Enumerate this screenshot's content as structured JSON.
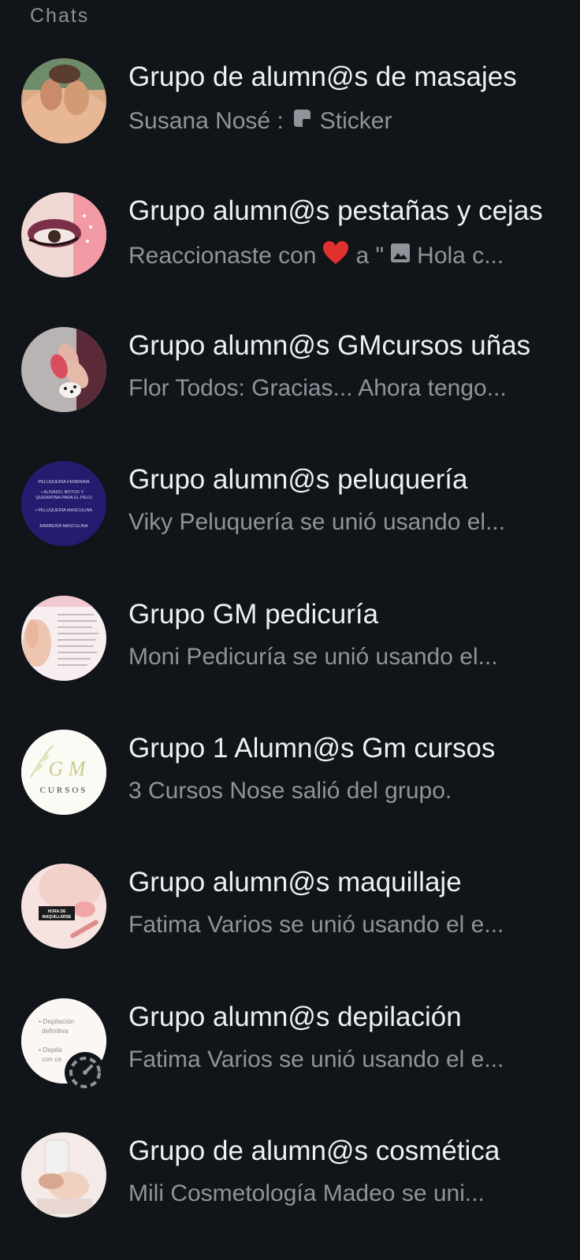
{
  "header": {
    "label": "Chats"
  },
  "chats": [
    {
      "title": "Grupo de alumn@s de masajes",
      "sender": "Susana Nosé :",
      "preview_icon": "sticker-icon",
      "preview": "Sticker",
      "avatar_icon": "massage-photo-avatar"
    },
    {
      "title": "Grupo alumn@s pestañas y cejas",
      "prefix": "Reaccionaste con",
      "reaction_icon": "heart-icon",
      "middle": "a \"",
      "preview_icon": "image-icon",
      "preview": "Hola c...",
      "avatar_icon": "eye-makeup-avatar"
    },
    {
      "title": "Grupo alumn@s GMcursos uñas",
      "preview": "Flor Todos: Gracias... Ahora tengo...",
      "avatar_icon": "nails-avatar"
    },
    {
      "title": "Grupo alumn@s peluquería",
      "preview": "Viky Peluquería se unió usando el...",
      "avatar_icon": "hairdressing-flyer-avatar",
      "avatar_text": [
        "PELUQUERÍA FEMENINA",
        "• ALISADO, BOTOX Y",
        "QUERATINA PARA EL PELO",
        "• PELUQUERÍA MASCULINA",
        "BARBERÍA MASCULINA"
      ]
    },
    {
      "title": "Grupo GM pedicuría",
      "preview": "Moni Pedicuría se unió usando el...",
      "avatar_icon": "pedicure-flyer-avatar"
    },
    {
      "title": "Grupo 1 Alumn@s Gm cursos",
      "preview": "3 Cursos Nose salió del grupo.",
      "avatar_icon": "gm-cursos-logo-avatar",
      "avatar_text": [
        "G M",
        "CURSOS"
      ]
    },
    {
      "title": "Grupo alumn@s maquillaje",
      "preview": "Fatima Varios se unió usando el e...",
      "avatar_icon": "makeup-avatar",
      "avatar_text": [
        "HORA DE",
        "MAQUILLARSE"
      ]
    },
    {
      "title": "Grupo alumn@s depilación",
      "preview": "Fatima Varios se unió usando el e...",
      "avatar_icon": "depilation-flyer-avatar",
      "avatar_text": [
        "• Depilación",
        "definitiva",
        "• Depila",
        "con ce"
      ],
      "badge_icon": "status-ring-icon"
    },
    {
      "title": "Grupo de alumn@s cosmética",
      "preview": "Mili Cosmetología Madeo se uni...",
      "avatar_icon": "cosmetics-avatar"
    }
  ],
  "colors": {
    "background": "#111418",
    "title": "#eef1f3",
    "preview": "#8d959b",
    "heart": "#e0312f"
  }
}
